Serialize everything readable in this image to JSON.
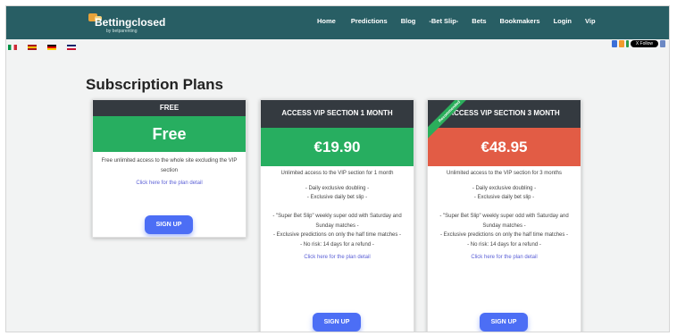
{
  "header": {
    "logo_text": "Bettingclosed",
    "logo_sub": "by betparenting",
    "nav": [
      "Home",
      "Predictions",
      "Blog",
      "-Bet Slip-",
      "Bets",
      "Bookmakers",
      "Login",
      "Vip"
    ]
  },
  "languages": [
    {
      "name": "italian-flag",
      "colors": [
        "#009246",
        "#ffffff",
        "#ce2b37"
      ]
    },
    {
      "name": "spanish-flag",
      "colors": [
        "#aa151b",
        "#f1bf00",
        "#aa151b"
      ]
    },
    {
      "name": "german-flag",
      "colors": [
        "#000000",
        "#dd0000",
        "#ffce00"
      ]
    },
    {
      "name": "uk-flag",
      "colors": [
        "#012169",
        "#ffffff",
        "#c8102e"
      ]
    }
  ],
  "social": {
    "follow_label": "X Follow"
  },
  "page": {
    "title": "Subscription Plans"
  },
  "plans": [
    {
      "name": "FREE",
      "price": "Free",
      "price_color": "#27ae60",
      "description": "Free unlimited access to the whole site excluding the VIP section",
      "features": [],
      "link": "Click here for the plan detail",
      "button": "SIGN UP"
    },
    {
      "name": "ACCESS VIP SECTION 1 MONTH",
      "price": "€19.90",
      "price_color": "#27ae60",
      "description": "Unlimited access to the VIP section for 1 month",
      "features": [
        "- Daily exclusive doubling -",
        "- Exclusive daily bet slip -",
        "",
        "- \"Super Bet Slip\" weekly super odd with Saturday and Sunday matches -",
        "- Exclusive predictions on only the half time matches -",
        "- No risk: 14 days for a refund -"
      ],
      "link": "Click here for the plan detail",
      "button": "SIGN UP"
    },
    {
      "name": "ACCESS VIP SECTION 3 MONTH",
      "price": "€48.95",
      "price_color": "#e25c45",
      "badge": "Recommended",
      "description": "Unlimited access to the VIP section for 3 months",
      "features": [
        "- Daily exclusive doubling -",
        "- Exclusive daily bet slip -",
        "",
        "- \"Super Bet Slip\" weekly super odd with Saturday and Sunday matches -",
        "- Exclusive predictions on only the half time matches -",
        "- No risk: 14 days for a refund -"
      ],
      "link": "Click here for the plan detail",
      "button": "SIGN UP"
    }
  ]
}
